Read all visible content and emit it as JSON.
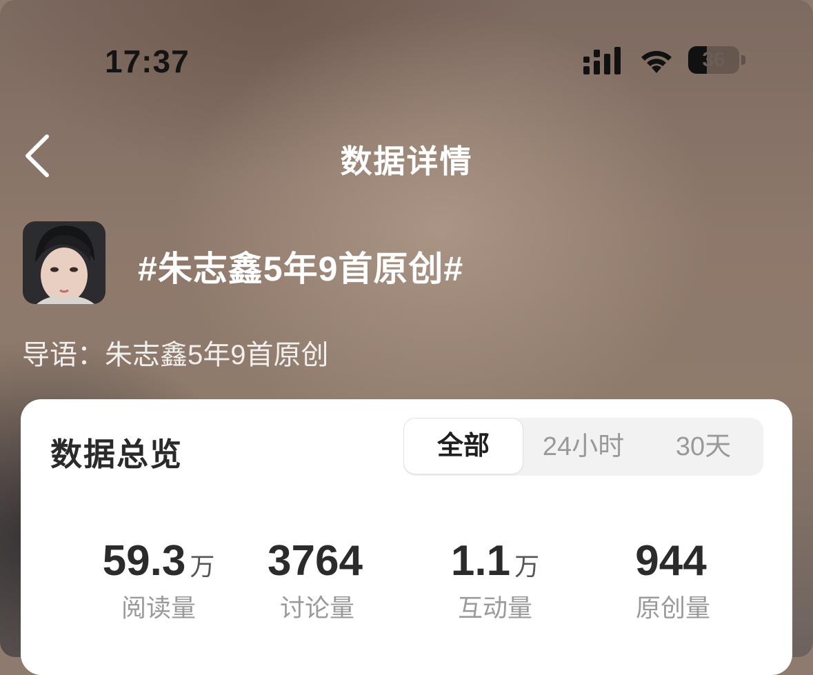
{
  "status_bar": {
    "time": "17:37",
    "battery_level": "36",
    "battery_fraction": 0.36,
    "icons": [
      "signal-icon",
      "wifi-icon",
      "battery-icon"
    ]
  },
  "nav": {
    "title": "数据详情",
    "back_icon": "chevron-left-icon"
  },
  "topic": {
    "title": "#朱志鑫5年9首原创#",
    "intro": "导语：朱志鑫5年9首原创"
  },
  "overview": {
    "title": "数据总览",
    "tabs": [
      {
        "label": "全部",
        "active": true
      },
      {
        "label": "24小时",
        "active": false
      },
      {
        "label": "30天",
        "active": false
      }
    ],
    "stats": [
      {
        "value": "59.3",
        "unit": "万",
        "label": "阅读量"
      },
      {
        "value": "3764",
        "unit": "",
        "label": "讨论量"
      },
      {
        "value": "1.1",
        "unit": "万",
        "label": "互动量"
      },
      {
        "value": "944",
        "unit": "",
        "label": "原创量"
      }
    ]
  },
  "colors": {
    "card_bg": "#ffffff",
    "title_text": "#ffffff",
    "stat_number": "#2b2b2b",
    "stat_label": "#9a9a9a",
    "tab_inactive": "#999999"
  }
}
